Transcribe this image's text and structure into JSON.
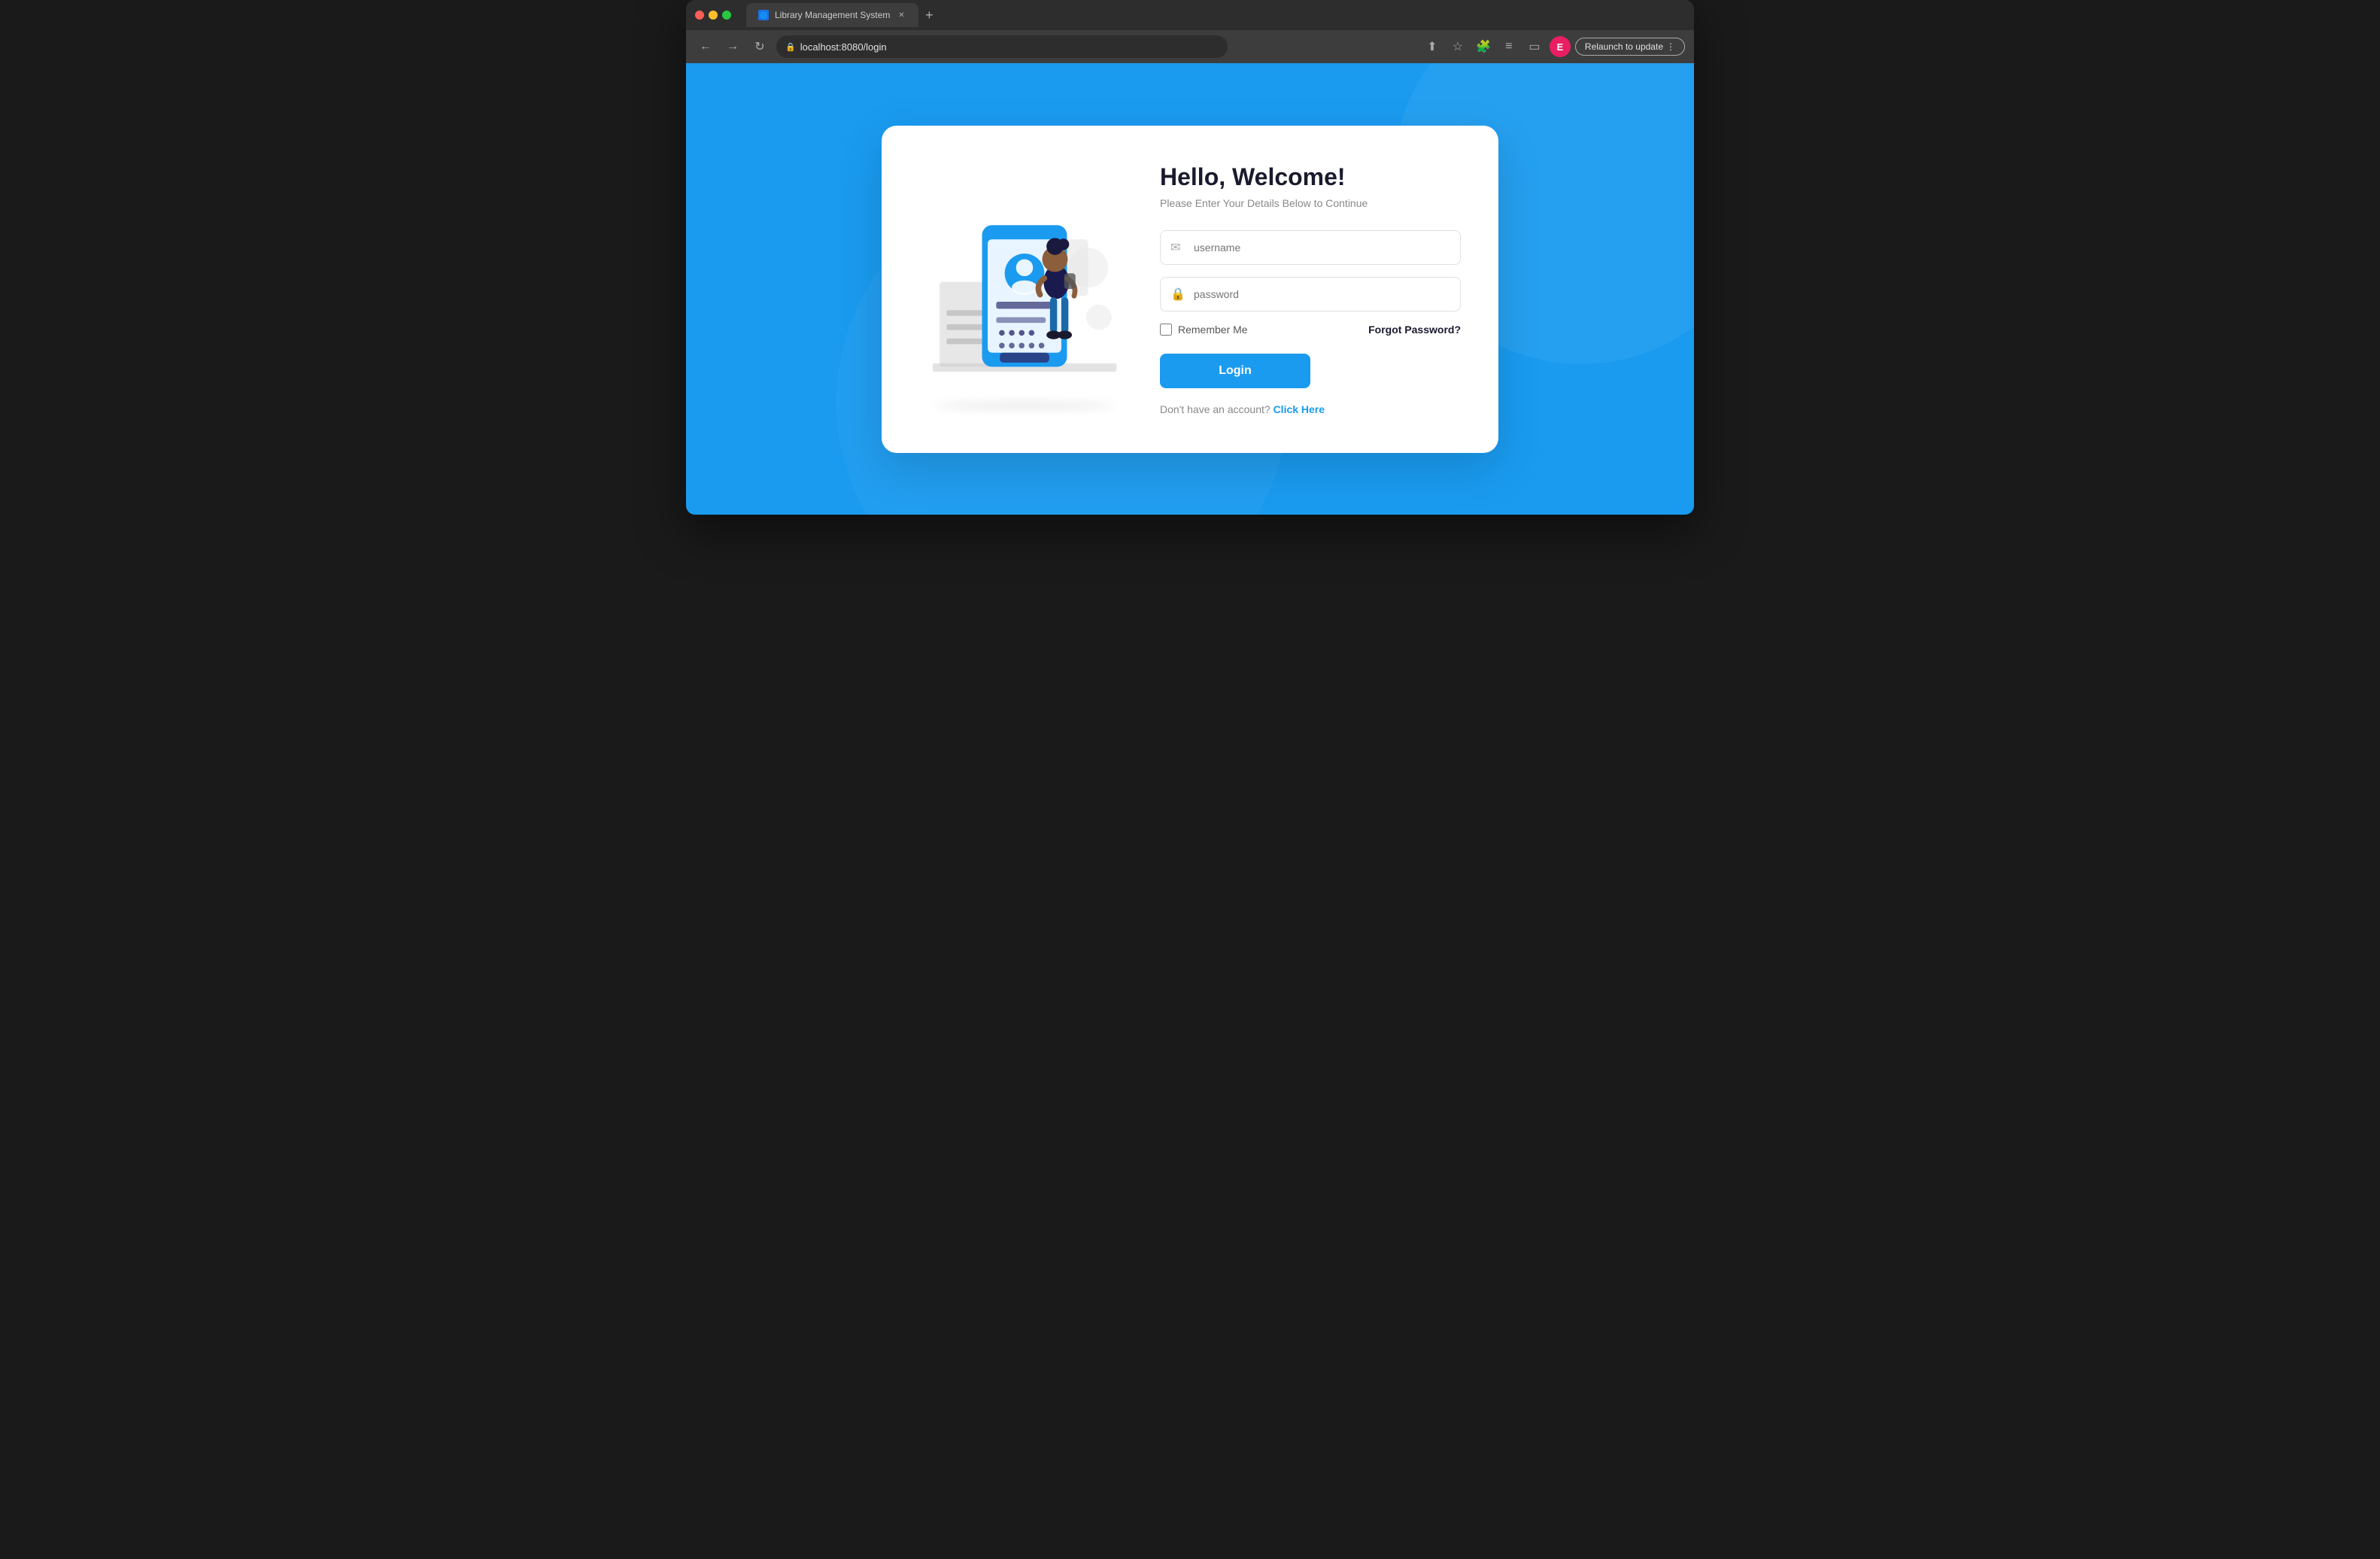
{
  "browser": {
    "tab_title": "Library Management System",
    "url": "localhost:8080/login",
    "new_tab_icon": "+",
    "relaunch_label": "Relaunch to update",
    "profile_initial": "E"
  },
  "page": {
    "background_color": "#1a9bf0"
  },
  "login": {
    "title": "Hello,  Welcome!",
    "subtitle": "Please Enter Your Details Below to Continue",
    "username_placeholder": "username",
    "password_placeholder": "password",
    "remember_label": "Remember Me",
    "forgot_label": "Forgot Password?",
    "login_btn_label": "Login",
    "signup_text": "Don't have an account?",
    "signup_link": "Click Here"
  }
}
